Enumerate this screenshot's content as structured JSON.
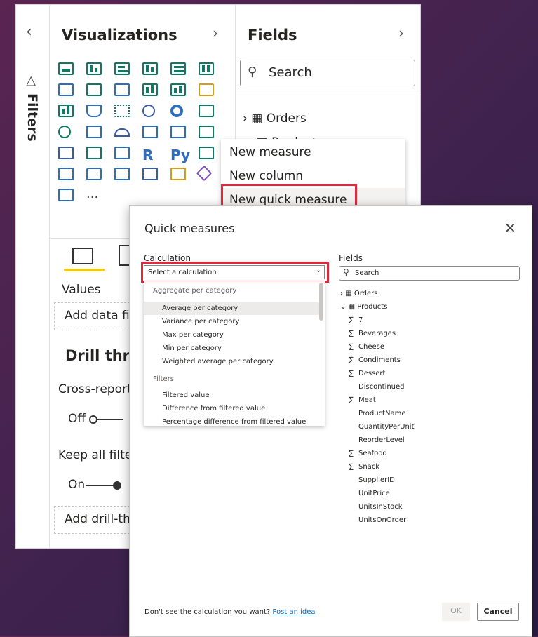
{
  "filters_strip": {
    "label": "Filters"
  },
  "visualizations": {
    "title": "Visualizations",
    "more_label": "...",
    "values_label": "Values",
    "add_data_fields": "Add data fie",
    "drill_through_title": "Drill thro",
    "cross_report_label": "Cross-report",
    "cross_report_state": "Off",
    "keep_filters_label": "Keep all filter",
    "keep_filters_state": "On",
    "add_drill_through": "Add drill-thr"
  },
  "fields_pane": {
    "title": "Fields",
    "search_placeholder": "Search",
    "tables": [
      "Orders",
      "Products"
    ]
  },
  "context_menu": {
    "items": [
      "New measure",
      "New column",
      "New quick measure"
    ]
  },
  "dialog": {
    "title": "Quick measures",
    "calculation_label": "Calculation",
    "select_placeholder": "Select a calculation",
    "fields_label": "Fields",
    "fields_search_placeholder": "Search",
    "dropdown": {
      "group1": "Aggregate per category",
      "group1_items": [
        "Average per category",
        "Variance per category",
        "Max per category",
        "Min per category",
        "Weighted average per category"
      ],
      "group2": "Filters",
      "group2_items": [
        "Filtered value",
        "Difference from filtered value",
        "Percentage difference from filtered value"
      ]
    },
    "fields_tree": {
      "orders": "Orders",
      "products": "Products",
      "columns": [
        {
          "name": "7",
          "sigma": true
        },
        {
          "name": "Beverages",
          "sigma": true
        },
        {
          "name": "Cheese",
          "sigma": true
        },
        {
          "name": "Condiments",
          "sigma": true
        },
        {
          "name": "Dessert",
          "sigma": true
        },
        {
          "name": "Discontinued",
          "sigma": false
        },
        {
          "name": "Meat",
          "sigma": true
        },
        {
          "name": "ProductName",
          "sigma": false
        },
        {
          "name": "QuantityPerUnit",
          "sigma": false
        },
        {
          "name": "ReorderLevel",
          "sigma": false
        },
        {
          "name": "Seafood",
          "sigma": true
        },
        {
          "name": "Snack",
          "sigma": true
        },
        {
          "name": "SupplierID",
          "sigma": false
        },
        {
          "name": "UnitPrice",
          "sigma": false
        },
        {
          "name": "UnitsInStock",
          "sigma": false
        },
        {
          "name": "UnitsOnOrder",
          "sigma": false
        }
      ]
    },
    "footer_text": "Don't see the calculation you want?",
    "footer_link": "Post an idea",
    "ok_label": "OK",
    "cancel_label": "Cancel"
  }
}
